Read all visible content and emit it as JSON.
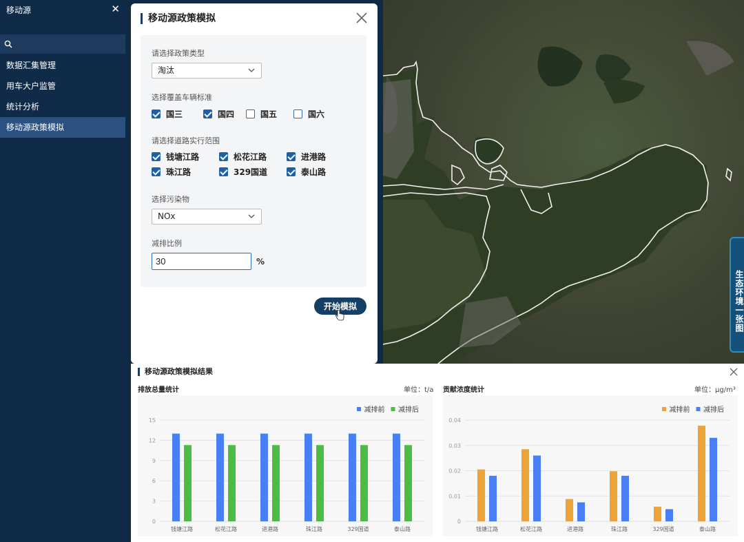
{
  "sidebar": {
    "title": "移动源",
    "search": {
      "placeholder": "",
      "value": ""
    },
    "items": [
      {
        "label": "数据汇集管理",
        "active": false
      },
      {
        "label": "用车大户监管",
        "active": false
      },
      {
        "label": "统计分析",
        "active": false
      },
      {
        "label": "移动源政策模拟",
        "active": true
      }
    ]
  },
  "map": {
    "side_tab_label": "生态环境一张图"
  },
  "policy_modal": {
    "title": "移动源政策模拟",
    "policy_type": {
      "label": "请选择政策类型",
      "value": "淘汰"
    },
    "vehicle_standard": {
      "label": "选择覆盖车辆标准",
      "options": [
        {
          "label": "国三",
          "checked": true
        },
        {
          "label": "国四",
          "checked": true
        },
        {
          "label": "国五",
          "checked": false
        },
        {
          "label": "国六",
          "checked": false
        }
      ]
    },
    "roads": {
      "label": "请选择道路实行范围",
      "options": [
        {
          "label": "钱塘江路",
          "checked": true
        },
        {
          "label": "松花江路",
          "checked": true
        },
        {
          "label": "进港路",
          "checked": true
        },
        {
          "label": "珠江路",
          "checked": true
        },
        {
          "label": "329国道",
          "checked": true
        },
        {
          "label": "泰山路",
          "checked": true
        }
      ]
    },
    "pollutant": {
      "label": "选择污染物",
      "value": "NOx"
    },
    "reduction": {
      "label": "减排比例",
      "value": "30",
      "unit": "%"
    },
    "start_button": "开始模拟"
  },
  "results": {
    "title": "移动源政策模拟结果",
    "colors": {
      "blue": "#4a7ef5",
      "green": "#4cbc45",
      "orange": "#eba33a"
    }
  },
  "chart_data": [
    {
      "type": "bar",
      "title": "排放总量统计",
      "unit_label": "单位：t/a",
      "categories": [
        "钱塘江路",
        "松花江路",
        "进港路",
        "珠江路",
        "329国道",
        "泰山路"
      ],
      "ylim": [
        0,
        15
      ],
      "yticks": [
        0,
        3,
        6,
        9,
        12,
        15
      ],
      "legend_position": "top-right",
      "grid": true,
      "series": [
        {
          "name": "减排前",
          "color": "#4a7ef5",
          "values": [
            13.0,
            13.0,
            13.0,
            13.0,
            13.0,
            13.0
          ]
        },
        {
          "name": "减排后",
          "color": "#4cbc45",
          "values": [
            11.3,
            11.3,
            11.3,
            11.3,
            11.3,
            11.3
          ]
        }
      ]
    },
    {
      "type": "bar",
      "title": "贡献浓度统计",
      "unit_label": "单位：μg/m³",
      "categories": [
        "钱塘江路",
        "松花江路",
        "进港路",
        "珠江路",
        "329国道",
        "泰山路"
      ],
      "ylim": [
        0,
        0.04
      ],
      "yticks": [
        0,
        0.01,
        0.02,
        0.03,
        0.04
      ],
      "legend_position": "top-right",
      "grid": true,
      "series": [
        {
          "name": "减排前",
          "color": "#eba33a",
          "values": [
            0.0205,
            0.0285,
            0.0088,
            0.0198,
            0.0058,
            0.0378
          ]
        },
        {
          "name": "减排后",
          "color": "#4a7ef5",
          "values": [
            0.018,
            0.026,
            0.0075,
            0.018,
            0.0048,
            0.033
          ]
        }
      ]
    }
  ]
}
